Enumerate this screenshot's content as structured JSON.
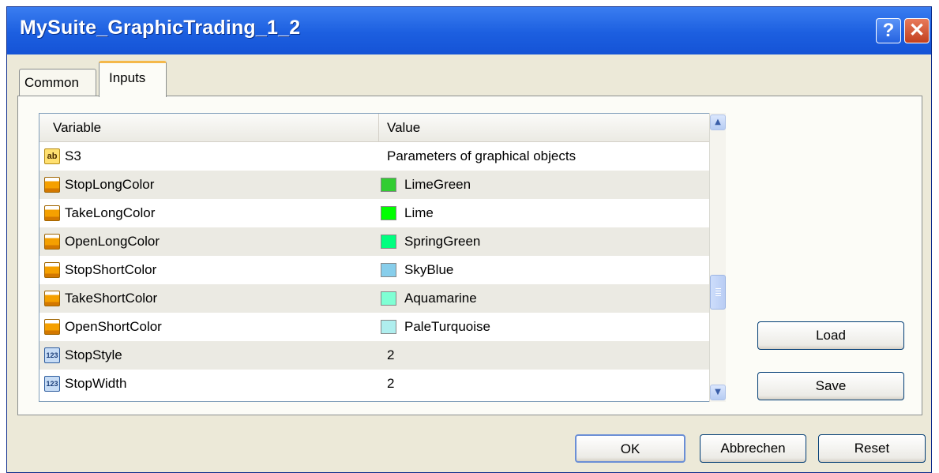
{
  "window": {
    "title": "MySuite_GraphicTrading_1_2"
  },
  "titlebar": {
    "help_label": "?",
    "close_label": "✕"
  },
  "tabs": [
    {
      "label": "Common",
      "selected": false
    },
    {
      "label": "Inputs",
      "selected": true
    }
  ],
  "grid": {
    "columns": {
      "variable": "Variable",
      "value": "Value"
    },
    "rows": [
      {
        "icon": "string-icon",
        "icon_text": "ab",
        "name": "S3",
        "value": "Parameters of graphical objects"
      },
      {
        "icon": "color-icon",
        "name": "StopLongColor",
        "value": "LimeGreen",
        "swatch": "#32cd32"
      },
      {
        "icon": "color-icon",
        "name": "TakeLongColor",
        "value": "Lime",
        "swatch": "#00ff00"
      },
      {
        "icon": "color-icon",
        "name": "OpenLongColor",
        "value": "SpringGreen",
        "swatch": "#00ff7f"
      },
      {
        "icon": "color-icon",
        "name": "StopShortColor",
        "value": "SkyBlue",
        "swatch": "#87ceeb"
      },
      {
        "icon": "color-icon",
        "name": "TakeShortColor",
        "value": "Aquamarine",
        "swatch": "#7fffd4"
      },
      {
        "icon": "color-icon",
        "name": "OpenShortColor",
        "value": "PaleTurquoise",
        "swatch": "#afeeee"
      },
      {
        "icon": "integer-icon",
        "icon_text": "123",
        "name": "StopStyle",
        "value": "2"
      },
      {
        "icon": "integer-icon",
        "icon_text": "123",
        "name": "StopWidth",
        "value": "2"
      }
    ]
  },
  "side_buttons": {
    "load_label": "Load",
    "save_label": "Save"
  },
  "footer": {
    "ok_label": "OK",
    "cancel_label": "Abbrechen",
    "reset_label": "Reset"
  },
  "colors": {
    "titlebar": "#1c5fe0",
    "dialog_bg": "#ece9d8",
    "alt_row": "#ebeae3"
  }
}
